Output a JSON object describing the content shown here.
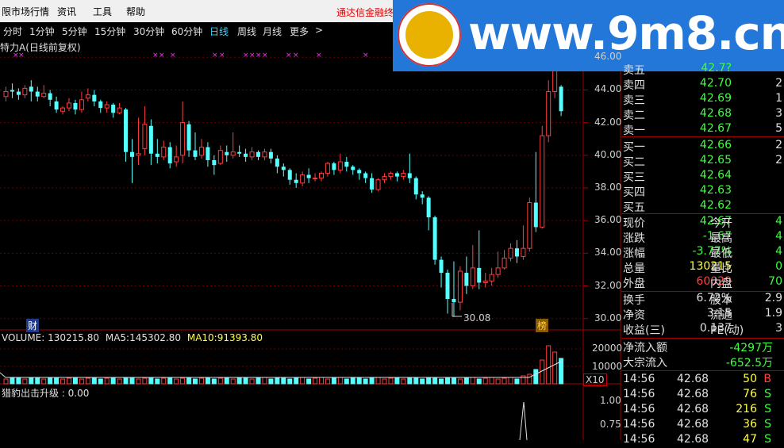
{
  "menu": {
    "items": [
      "限市场行情",
      "资讯",
      "工具",
      "帮助"
    ],
    "promo": "通达信金融终"
  },
  "periods": {
    "items": [
      "分时",
      "1分钟",
      "5分钟",
      "15分钟",
      "30分钟",
      "60分钟",
      "日线",
      "周线",
      "月线",
      "更多",
      ">"
    ],
    "active": "日线"
  },
  "chart_title": "特力A(日线前复权)",
  "watermark": {
    "site": "www.9m8.cn",
    "logo_text": "www.9m8.cn"
  },
  "price_axis": {
    "ticks": [
      "46.00",
      "44.00",
      "42.00",
      "40.00",
      "38.00",
      "36.00",
      "34.00",
      "32.00",
      "30.00"
    ]
  },
  "markers": {
    "cai": "财",
    "bang": "榜",
    "low_label": "30.08"
  },
  "volume": {
    "header": {
      "vol_label": "VOLUME:",
      "vol_value": "130215.80",
      "ma5_label": "MA5:",
      "ma5_value": "145302.80",
      "ma10_label": "MA10:",
      "ma10_value": "91393.80"
    },
    "axis": [
      "20000",
      "10000"
    ],
    "unit": "X10"
  },
  "indicator": {
    "title": "猎豹出击升级 : 0.00",
    "axis": [
      "1.00",
      "0.75"
    ]
  },
  "quotes": {
    "asks": [
      {
        "label": "卖五",
        "price": "42.7?",
        "vol": ""
      },
      {
        "label": "卖四",
        "price": "42.70",
        "vol": "2"
      },
      {
        "label": "卖三",
        "price": "42.69",
        "vol": "1"
      },
      {
        "label": "卖二",
        "price": "42.68",
        "vol": "3"
      },
      {
        "label": "卖一",
        "price": "42.67",
        "vol": "5"
      }
    ],
    "bids": [
      {
        "label": "买一",
        "price": "42.66",
        "vol": "2"
      },
      {
        "label": "买二",
        "price": "42.65",
        "vol": "2"
      },
      {
        "label": "买三",
        "price": "42.64",
        "vol": ""
      },
      {
        "label": "买四",
        "price": "42.63",
        "vol": ""
      },
      {
        "label": "买五",
        "price": "42.62",
        "vol": ""
      }
    ],
    "stats": [
      {
        "l1": "现价",
        "v1": "42.67",
        "c1": "g",
        "l2": "今开",
        "v2": "4"
      },
      {
        "l1": "涨跌",
        "v1": "-1.67",
        "c1": "g",
        "l2": "最高",
        "v2": "4"
      },
      {
        "l1": "涨幅",
        "v1": "-3.77%",
        "c1": "g",
        "l2": "最低",
        "v2": "4"
      },
      {
        "l1": "总量",
        "v1": "130215",
        "c1": "y",
        "l2": "量比",
        "v2": "0"
      },
      {
        "l1": "外盘",
        "v1": "60029",
        "c1": "r",
        "l2": "内盘",
        "v2": "70"
      }
    ],
    "stats2": [
      {
        "l1": "换手",
        "v1": "6.72%",
        "l2": "股本",
        "v2": "2.9"
      },
      {
        "l1": "净资",
        "v1": "3.15",
        "l2": "流通",
        "v2": "1.9"
      },
      {
        "l1": "收益(三)",
        "v1": "0.137",
        "l2": "PE(动)",
        "v2": "3"
      }
    ],
    "flows": [
      {
        "label": "净流入额",
        "value": "-4297万"
      },
      {
        "label": "大宗流入",
        "value": "-652.5万"
      }
    ],
    "ticks": [
      {
        "time": "14:56",
        "price": "42.68",
        "vol": "50",
        "side": "B"
      },
      {
        "time": "14:56",
        "price": "42.68",
        "vol": "76",
        "side": "S"
      },
      {
        "time": "14:56",
        "price": "42.68",
        "vol": "216",
        "side": "S"
      },
      {
        "time": "14:56",
        "price": "42.68",
        "vol": "36",
        "side": "S"
      },
      {
        "time": "14:56",
        "price": "42.68",
        "vol": "47",
        "side": "S"
      }
    ]
  },
  "chart_data": {
    "type": "candlestick",
    "title": "特力A(日线前复权)",
    "ylim": [
      29.5,
      46.5
    ],
    "candles": [
      [
        43.6,
        43.9,
        43.3,
        44.2
      ],
      [
        44.0,
        43.9,
        43.5,
        44.4
      ],
      [
        43.9,
        43.7,
        43.4,
        44.1
      ],
      [
        43.7,
        44.1,
        43.5,
        44.3
      ],
      [
        44.2,
        43.9,
        43.3,
        44.6
      ],
      [
        43.9,
        43.6,
        43.3,
        44.2
      ],
      [
        43.6,
        43.8,
        43.5,
        44.3
      ],
      [
        43.8,
        43.4,
        43.0,
        44.0
      ],
      [
        43.3,
        42.8,
        42.6,
        43.6
      ],
      [
        42.7,
        42.9,
        42.5,
        43.0
      ],
      [
        42.9,
        43.2,
        42.7,
        43.5
      ],
      [
        43.2,
        42.8,
        42.5,
        43.4
      ],
      [
        42.8,
        43.4,
        42.6,
        43.9
      ],
      [
        43.5,
        43.7,
        43.3,
        44.1
      ],
      [
        43.7,
        43.3,
        43.0,
        44.0
      ],
      [
        43.3,
        42.9,
        42.6,
        43.4
      ],
      [
        42.9,
        43.1,
        42.6,
        43.3
      ],
      [
        43.1,
        42.6,
        42.3,
        43.2
      ],
      [
        42.6,
        42.9,
        42.5,
        43.2
      ],
      [
        42.8,
        40.2,
        39.6,
        42.9
      ],
      [
        40.2,
        39.9,
        38.3,
        41.0
      ],
      [
        40.0,
        40.1,
        39.4,
        42.3
      ],
      [
        40.4,
        41.9,
        40.0,
        43.0
      ],
      [
        41.8,
        40.1,
        39.4,
        42.2
      ],
      [
        40.1,
        39.9,
        39.5,
        41.0
      ],
      [
        39.9,
        40.5,
        39.7,
        40.9
      ],
      [
        40.5,
        39.5,
        39.2,
        40.8
      ],
      [
        39.6,
        39.9,
        39.3,
        40.6
      ],
      [
        40.0,
        42.0,
        39.5,
        43.3
      ],
      [
        41.9,
        40.3,
        39.9,
        42.1
      ],
      [
        40.3,
        39.9,
        39.7,
        41.4
      ],
      [
        40.0,
        40.5,
        39.8,
        41.0
      ],
      [
        40.5,
        39.7,
        39.3,
        40.8
      ],
      [
        39.7,
        39.4,
        38.8,
        40.0
      ],
      [
        39.5,
        40.3,
        39.4,
        40.6
      ],
      [
        40.2,
        40.0,
        39.6,
        40.6
      ],
      [
        40.0,
        40.2,
        39.8,
        41.4
      ],
      [
        40.2,
        40.1,
        39.9,
        40.6
      ],
      [
        40.1,
        39.9,
        39.6,
        40.4
      ],
      [
        39.9,
        40.2,
        39.7,
        40.5
      ],
      [
        40.2,
        39.9,
        39.7,
        40.3
      ],
      [
        39.9,
        40.2,
        39.7,
        40.4
      ],
      [
        40.2,
        39.8,
        39.5,
        40.4
      ],
      [
        39.8,
        39.3,
        38.9,
        40.0
      ],
      [
        39.3,
        39.1,
        38.7,
        39.5
      ],
      [
        39.1,
        38.5,
        38.2,
        39.2
      ],
      [
        38.5,
        38.3,
        38.0,
        38.9
      ],
      [
        38.3,
        38.8,
        38.1,
        39.0
      ],
      [
        38.8,
        38.6,
        38.3,
        39.2
      ],
      [
        38.6,
        38.6,
        38.4,
        38.9
      ],
      [
        38.6,
        38.9,
        38.4,
        39.0
      ],
      [
        38.9,
        39.5,
        38.7,
        39.6
      ],
      [
        39.5,
        39.1,
        38.8,
        39.6
      ],
      [
        39.1,
        39.6,
        38.9,
        40.1
      ],
      [
        39.6,
        39.3,
        39.0,
        39.9
      ],
      [
        39.3,
        39.1,
        38.8,
        39.4
      ],
      [
        39.1,
        38.9,
        38.5,
        39.2
      ],
      [
        38.9,
        38.6,
        38.3,
        39.0
      ],
      [
        38.6,
        37.9,
        37.7,
        38.9
      ],
      [
        37.9,
        38.5,
        37.8,
        38.6
      ],
      [
        38.5,
        38.7,
        38.3,
        38.9
      ],
      [
        38.7,
        38.9,
        38.5,
        39.0
      ],
      [
        38.9,
        38.7,
        38.4,
        39.0
      ],
      [
        38.7,
        38.9,
        38.5,
        39.1
      ],
      [
        38.9,
        38.6,
        38.3,
        40.1
      ],
      [
        38.6,
        37.6,
        37.3,
        38.7
      ],
      [
        37.6,
        37.4,
        37.0,
        37.8
      ],
      [
        37.4,
        36.2,
        35.4,
        37.5
      ],
      [
        36.2,
        33.6,
        33.3,
        36.3
      ],
      [
        33.6,
        32.8,
        31.9,
        33.8
      ],
      [
        32.8,
        31.2,
        30.3,
        33.0
      ],
      [
        31.2,
        31.0,
        30.1,
        33.5
      ],
      [
        31.0,
        32.9,
        30.5,
        33.2
      ],
      [
        32.8,
        32.0,
        31.5,
        33.8
      ],
      [
        32.0,
        33.1,
        31.8,
        34.5
      ],
      [
        33.1,
        32.2,
        31.8,
        35.4
      ],
      [
        32.2,
        32.3,
        31.9,
        32.8
      ],
      [
        32.3,
        32.7,
        32.0,
        33.1
      ],
      [
        32.7,
        33.1,
        32.5,
        34.1
      ],
      [
        33.1,
        33.7,
        33.0,
        34.2
      ],
      [
        33.7,
        34.3,
        33.5,
        34.6
      ],
      [
        34.3,
        33.8,
        33.4,
        34.8
      ],
      [
        33.8,
        34.3,
        33.6,
        35.7
      ],
      [
        34.3,
        37.1,
        34.1,
        37.4
      ],
      [
        37.1,
        35.6,
        35.3,
        40.2
      ],
      [
        35.6,
        41.2,
        35.5,
        41.8
      ],
      [
        41.2,
        43.9,
        40.8,
        44.6
      ],
      [
        43.9,
        45.8,
        43.5,
        46.2
      ],
      [
        44.2,
        42.7,
        42.4,
        44.3
      ]
    ]
  }
}
